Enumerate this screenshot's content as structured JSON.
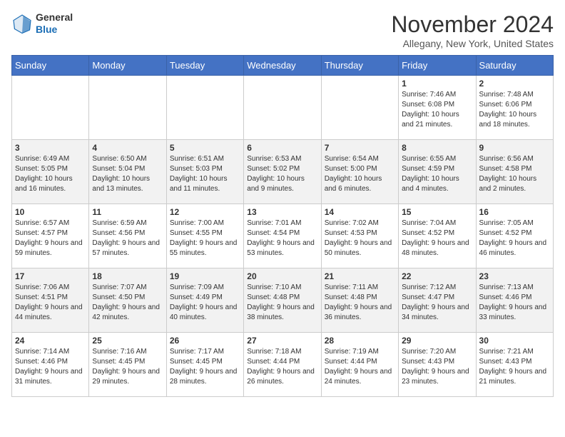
{
  "header": {
    "logo_line1": "General",
    "logo_line2": "Blue",
    "month": "November 2024",
    "location": "Allegany, New York, United States"
  },
  "days_of_week": [
    "Sunday",
    "Monday",
    "Tuesday",
    "Wednesday",
    "Thursday",
    "Friday",
    "Saturday"
  ],
  "weeks": [
    [
      {
        "day": "",
        "info": ""
      },
      {
        "day": "",
        "info": ""
      },
      {
        "day": "",
        "info": ""
      },
      {
        "day": "",
        "info": ""
      },
      {
        "day": "",
        "info": ""
      },
      {
        "day": "1",
        "info": "Sunrise: 7:46 AM\nSunset: 6:08 PM\nDaylight: 10 hours and 21 minutes."
      },
      {
        "day": "2",
        "info": "Sunrise: 7:48 AM\nSunset: 6:06 PM\nDaylight: 10 hours and 18 minutes."
      }
    ],
    [
      {
        "day": "3",
        "info": "Sunrise: 6:49 AM\nSunset: 5:05 PM\nDaylight: 10 hours and 16 minutes."
      },
      {
        "day": "4",
        "info": "Sunrise: 6:50 AM\nSunset: 5:04 PM\nDaylight: 10 hours and 13 minutes."
      },
      {
        "day": "5",
        "info": "Sunrise: 6:51 AM\nSunset: 5:03 PM\nDaylight: 10 hours and 11 minutes."
      },
      {
        "day": "6",
        "info": "Sunrise: 6:53 AM\nSunset: 5:02 PM\nDaylight: 10 hours and 9 minutes."
      },
      {
        "day": "7",
        "info": "Sunrise: 6:54 AM\nSunset: 5:00 PM\nDaylight: 10 hours and 6 minutes."
      },
      {
        "day": "8",
        "info": "Sunrise: 6:55 AM\nSunset: 4:59 PM\nDaylight: 10 hours and 4 minutes."
      },
      {
        "day": "9",
        "info": "Sunrise: 6:56 AM\nSunset: 4:58 PM\nDaylight: 10 hours and 2 minutes."
      }
    ],
    [
      {
        "day": "10",
        "info": "Sunrise: 6:57 AM\nSunset: 4:57 PM\nDaylight: 9 hours and 59 minutes."
      },
      {
        "day": "11",
        "info": "Sunrise: 6:59 AM\nSunset: 4:56 PM\nDaylight: 9 hours and 57 minutes."
      },
      {
        "day": "12",
        "info": "Sunrise: 7:00 AM\nSunset: 4:55 PM\nDaylight: 9 hours and 55 minutes."
      },
      {
        "day": "13",
        "info": "Sunrise: 7:01 AM\nSunset: 4:54 PM\nDaylight: 9 hours and 53 minutes."
      },
      {
        "day": "14",
        "info": "Sunrise: 7:02 AM\nSunset: 4:53 PM\nDaylight: 9 hours and 50 minutes."
      },
      {
        "day": "15",
        "info": "Sunrise: 7:04 AM\nSunset: 4:52 PM\nDaylight: 9 hours and 48 minutes."
      },
      {
        "day": "16",
        "info": "Sunrise: 7:05 AM\nSunset: 4:52 PM\nDaylight: 9 hours and 46 minutes."
      }
    ],
    [
      {
        "day": "17",
        "info": "Sunrise: 7:06 AM\nSunset: 4:51 PM\nDaylight: 9 hours and 44 minutes."
      },
      {
        "day": "18",
        "info": "Sunrise: 7:07 AM\nSunset: 4:50 PM\nDaylight: 9 hours and 42 minutes."
      },
      {
        "day": "19",
        "info": "Sunrise: 7:09 AM\nSunset: 4:49 PM\nDaylight: 9 hours and 40 minutes."
      },
      {
        "day": "20",
        "info": "Sunrise: 7:10 AM\nSunset: 4:48 PM\nDaylight: 9 hours and 38 minutes."
      },
      {
        "day": "21",
        "info": "Sunrise: 7:11 AM\nSunset: 4:48 PM\nDaylight: 9 hours and 36 minutes."
      },
      {
        "day": "22",
        "info": "Sunrise: 7:12 AM\nSunset: 4:47 PM\nDaylight: 9 hours and 34 minutes."
      },
      {
        "day": "23",
        "info": "Sunrise: 7:13 AM\nSunset: 4:46 PM\nDaylight: 9 hours and 33 minutes."
      }
    ],
    [
      {
        "day": "24",
        "info": "Sunrise: 7:14 AM\nSunset: 4:46 PM\nDaylight: 9 hours and 31 minutes."
      },
      {
        "day": "25",
        "info": "Sunrise: 7:16 AM\nSunset: 4:45 PM\nDaylight: 9 hours and 29 minutes."
      },
      {
        "day": "26",
        "info": "Sunrise: 7:17 AM\nSunset: 4:45 PM\nDaylight: 9 hours and 28 minutes."
      },
      {
        "day": "27",
        "info": "Sunrise: 7:18 AM\nSunset: 4:44 PM\nDaylight: 9 hours and 26 minutes."
      },
      {
        "day": "28",
        "info": "Sunrise: 7:19 AM\nSunset: 4:44 PM\nDaylight: 9 hours and 24 minutes."
      },
      {
        "day": "29",
        "info": "Sunrise: 7:20 AM\nSunset: 4:43 PM\nDaylight: 9 hours and 23 minutes."
      },
      {
        "day": "30",
        "info": "Sunrise: 7:21 AM\nSunset: 4:43 PM\nDaylight: 9 hours and 21 minutes."
      }
    ]
  ]
}
